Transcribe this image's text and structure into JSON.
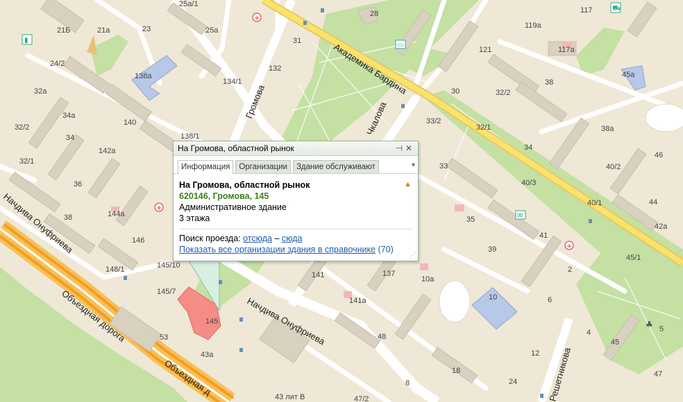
{
  "popup": {
    "header_title": "На Громова, областной рынок",
    "pin_icon": "pin-icon",
    "close_icon": "close-icon",
    "tabs": [
      "Информация",
      "Организации",
      "Здание обслуживают"
    ],
    "active_tab": "Информация",
    "name": "На Громова, областной рынок",
    "address": "620146, Громова, 145",
    "type": "Административное здание",
    "floors": "3 этажа",
    "route_label": "Поиск проезда:",
    "route_from": "отсюда",
    "route_dash": "–",
    "route_to": "сюда",
    "show_all_link": "Показать все организации здания в справочнике",
    "org_count": "(70)"
  },
  "map": {
    "streets": {
      "akademika_bardina": "Академика Бардина",
      "gromova": "Громова",
      "chkalova": "Чкалова",
      "nachdiva_onufrieva_top": "Начдива Онуфриева",
      "nachdiva_onufrieva_bottom": "Начдива Онуфриева",
      "obezdnaya_1": "Объездная дорога",
      "obezdnaya_2": "Объездная д",
      "reshetnikova": "Решетникова"
    },
    "building_numbers": [
      "25а/1",
      "28",
      "117",
      "25а",
      "21Б",
      "21а",
      "23",
      "31",
      "119а",
      "117а",
      "24/2",
      "138а",
      "132",
      "121",
      "45а",
      "32а",
      "134/1",
      "30",
      "32/2",
      "38",
      "34а",
      "140",
      "33/2",
      "32/2",
      "32/1",
      "34",
      "138/1",
      "38а",
      "142а",
      "34",
      "46",
      "32/1",
      "33",
      "40/2",
      "36",
      "40/3",
      "44",
      "40/1",
      "144а",
      "38",
      "35",
      "42а",
      "41",
      "146",
      "39",
      "45/1",
      "148/1",
      "145/10",
      "141",
      "137",
      "10а",
      "2",
      "145/7",
      "141а",
      "10",
      "6",
      "145",
      "53",
      "4",
      "48",
      "5",
      "43а",
      "12",
      "45",
      "24",
      "18",
      "47",
      "43 лит В",
      "47/2",
      "8"
    ],
    "icons": [
      "medical-cross-icon",
      "tram-stop-icon",
      "bookshop-icon",
      "shop-cart-icon",
      "post-office-icon",
      "fuel-icon",
      "park-icon"
    ]
  }
}
